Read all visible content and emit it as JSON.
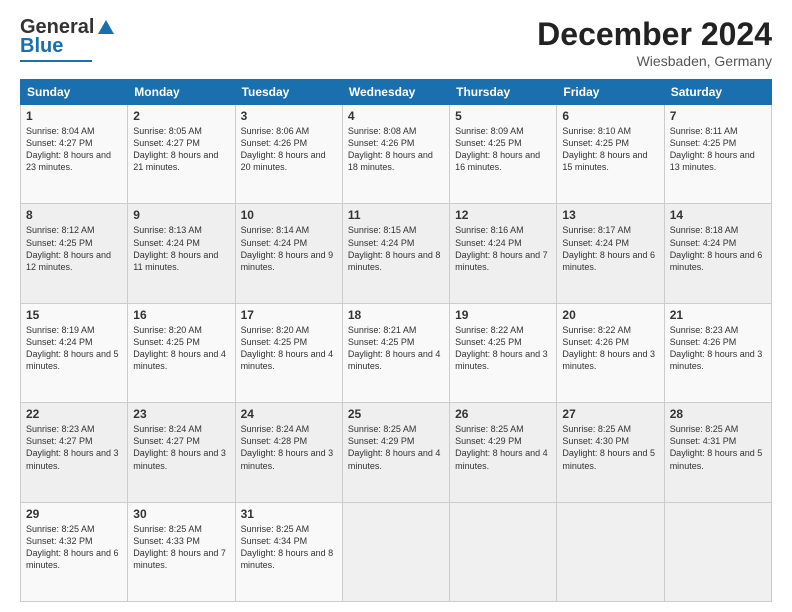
{
  "logo": {
    "line1": "General",
    "line2": "Blue"
  },
  "header": {
    "month": "December 2024",
    "location": "Wiesbaden, Germany"
  },
  "days": [
    "Sunday",
    "Monday",
    "Tuesday",
    "Wednesday",
    "Thursday",
    "Friday",
    "Saturday"
  ],
  "weeks": [
    [
      {
        "num": "1",
        "sunrise": "8:04 AM",
        "sunset": "4:27 PM",
        "daylight": "8 hours and 23 minutes."
      },
      {
        "num": "2",
        "sunrise": "8:05 AM",
        "sunset": "4:27 PM",
        "daylight": "8 hours and 21 minutes."
      },
      {
        "num": "3",
        "sunrise": "8:06 AM",
        "sunset": "4:26 PM",
        "daylight": "8 hours and 20 minutes."
      },
      {
        "num": "4",
        "sunrise": "8:08 AM",
        "sunset": "4:26 PM",
        "daylight": "8 hours and 18 minutes."
      },
      {
        "num": "5",
        "sunrise": "8:09 AM",
        "sunset": "4:25 PM",
        "daylight": "8 hours and 16 minutes."
      },
      {
        "num": "6",
        "sunrise": "8:10 AM",
        "sunset": "4:25 PM",
        "daylight": "8 hours and 15 minutes."
      },
      {
        "num": "7",
        "sunrise": "8:11 AM",
        "sunset": "4:25 PM",
        "daylight": "8 hours and 13 minutes."
      }
    ],
    [
      {
        "num": "8",
        "sunrise": "8:12 AM",
        "sunset": "4:25 PM",
        "daylight": "8 hours and 12 minutes."
      },
      {
        "num": "9",
        "sunrise": "8:13 AM",
        "sunset": "4:24 PM",
        "daylight": "8 hours and 11 minutes."
      },
      {
        "num": "10",
        "sunrise": "8:14 AM",
        "sunset": "4:24 PM",
        "daylight": "8 hours and 9 minutes."
      },
      {
        "num": "11",
        "sunrise": "8:15 AM",
        "sunset": "4:24 PM",
        "daylight": "8 hours and 8 minutes."
      },
      {
        "num": "12",
        "sunrise": "8:16 AM",
        "sunset": "4:24 PM",
        "daylight": "8 hours and 7 minutes."
      },
      {
        "num": "13",
        "sunrise": "8:17 AM",
        "sunset": "4:24 PM",
        "daylight": "8 hours and 6 minutes."
      },
      {
        "num": "14",
        "sunrise": "8:18 AM",
        "sunset": "4:24 PM",
        "daylight": "8 hours and 6 minutes."
      }
    ],
    [
      {
        "num": "15",
        "sunrise": "8:19 AM",
        "sunset": "4:24 PM",
        "daylight": "8 hours and 5 minutes."
      },
      {
        "num": "16",
        "sunrise": "8:20 AM",
        "sunset": "4:25 PM",
        "daylight": "8 hours and 4 minutes."
      },
      {
        "num": "17",
        "sunrise": "8:20 AM",
        "sunset": "4:25 PM",
        "daylight": "8 hours and 4 minutes."
      },
      {
        "num": "18",
        "sunrise": "8:21 AM",
        "sunset": "4:25 PM",
        "daylight": "8 hours and 4 minutes."
      },
      {
        "num": "19",
        "sunrise": "8:22 AM",
        "sunset": "4:25 PM",
        "daylight": "8 hours and 3 minutes."
      },
      {
        "num": "20",
        "sunrise": "8:22 AM",
        "sunset": "4:26 PM",
        "daylight": "8 hours and 3 minutes."
      },
      {
        "num": "21",
        "sunrise": "8:23 AM",
        "sunset": "4:26 PM",
        "daylight": "8 hours and 3 minutes."
      }
    ],
    [
      {
        "num": "22",
        "sunrise": "8:23 AM",
        "sunset": "4:27 PM",
        "daylight": "8 hours and 3 minutes."
      },
      {
        "num": "23",
        "sunrise": "8:24 AM",
        "sunset": "4:27 PM",
        "daylight": "8 hours and 3 minutes."
      },
      {
        "num": "24",
        "sunrise": "8:24 AM",
        "sunset": "4:28 PM",
        "daylight": "8 hours and 3 minutes."
      },
      {
        "num": "25",
        "sunrise": "8:25 AM",
        "sunset": "4:29 PM",
        "daylight": "8 hours and 4 minutes."
      },
      {
        "num": "26",
        "sunrise": "8:25 AM",
        "sunset": "4:29 PM",
        "daylight": "8 hours and 4 minutes."
      },
      {
        "num": "27",
        "sunrise": "8:25 AM",
        "sunset": "4:30 PM",
        "daylight": "8 hours and 5 minutes."
      },
      {
        "num": "28",
        "sunrise": "8:25 AM",
        "sunset": "4:31 PM",
        "daylight": "8 hours and 5 minutes."
      }
    ],
    [
      {
        "num": "29",
        "sunrise": "8:25 AM",
        "sunset": "4:32 PM",
        "daylight": "8 hours and 6 minutes."
      },
      {
        "num": "30",
        "sunrise": "8:25 AM",
        "sunset": "4:33 PM",
        "daylight": "8 hours and 7 minutes."
      },
      {
        "num": "31",
        "sunrise": "8:25 AM",
        "sunset": "4:34 PM",
        "daylight": "8 hours and 8 minutes."
      },
      null,
      null,
      null,
      null
    ]
  ]
}
